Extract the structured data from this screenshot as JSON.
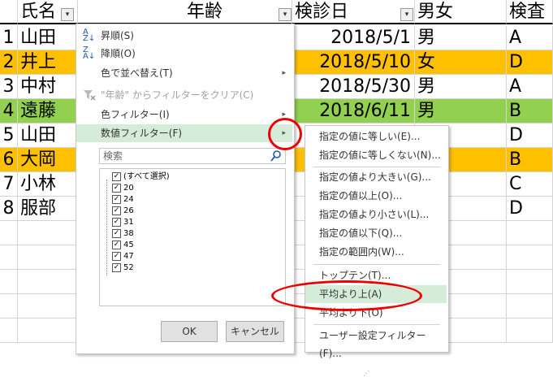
{
  "sheet": {
    "headers": [
      "氏名",
      "年齢",
      "検診日",
      "男女",
      "検査"
    ],
    "rows": [
      {
        "num": "1",
        "name": "山田",
        "date": "2018/5/1",
        "sex": "男",
        "grade": "A",
        "color": "none"
      },
      {
        "num": "2",
        "name": "井上",
        "date": "2018/5/10",
        "sex": "女",
        "grade": "D",
        "color": "orange"
      },
      {
        "num": "3",
        "name": "中村",
        "date": "2018/5/30",
        "sex": "男",
        "grade": "A",
        "color": "none"
      },
      {
        "num": "4",
        "name": "遠藤",
        "date": "2018/6/11",
        "sex": "男",
        "grade": "B",
        "color": "green"
      },
      {
        "num": "5",
        "name": "山田",
        "date": "",
        "sex": "",
        "grade": "D",
        "color": "none"
      },
      {
        "num": "6",
        "name": "大岡",
        "date": "",
        "sex": "",
        "grade": "B",
        "color": "orange"
      },
      {
        "num": "7",
        "name": "小林",
        "date": "",
        "sex": "",
        "grade": "C",
        "color": "none"
      },
      {
        "num": "8",
        "name": "服部",
        "date": "",
        "sex": "",
        "grade": "D",
        "color": "none"
      }
    ],
    "filter_button_glyph": "▾",
    "highlight_colors": {
      "orange": "#ffc000",
      "green": "#92d050",
      "menu_highlight": "#d5ecd9",
      "circle": "#e00000"
    }
  },
  "menu": {
    "items": [
      {
        "label": "昇順(S)",
        "icon": "sort-ascending-icon"
      },
      {
        "label": "降順(O)",
        "icon": "sort-descending-icon"
      },
      {
        "label": "色で並べ替え(T)",
        "arrow": "▸"
      },
      {
        "label": "\"年齢\" からフィルターをクリア(C)",
        "icon": "clear-filter-icon",
        "disabled": true
      },
      {
        "label": "色フィルター(I)",
        "arrow": "▸"
      },
      {
        "label": "数値フィルター(F)",
        "arrow": "▸",
        "highlighted": true
      }
    ],
    "search_placeholder": "検索",
    "list": [
      "(すべて選択)",
      "20",
      "24",
      "26",
      "31",
      "38",
      "45",
      "47",
      "52"
    ],
    "check_glyph": "✓",
    "ok_label": "OK",
    "cancel_label": "キャンセル"
  },
  "submenu": {
    "items": [
      "指定の値に等しい(E)...",
      "指定の値に等しくない(N)...",
      "指定の値より大きい(G)...",
      "指定の値以上(O)...",
      "指定の値より小さい(L)...",
      "指定の値以下(Q)...",
      "指定の範囲内(W)...",
      "トップテン(T)...",
      "平均より上(A)",
      "平均より下(O)",
      "ユーザー設定フィルター(F)..."
    ],
    "highlighted_index": 8
  }
}
